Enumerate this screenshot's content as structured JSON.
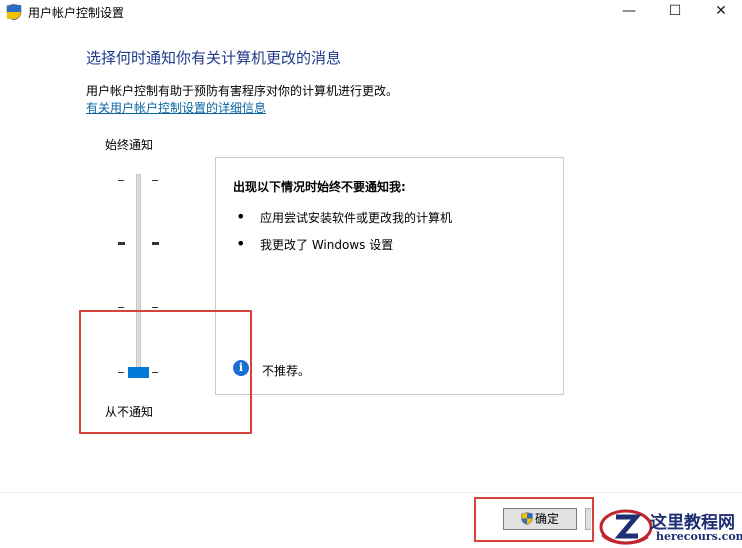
{
  "window": {
    "title": "用户帐户控制设置",
    "controls": {
      "minimize": "—",
      "maximize": "☐",
      "close": "✕"
    }
  },
  "main": {
    "headline": "选择何时通知你有关计算机更改的消息",
    "description": "用户帐户控制有助于预防有害程序对你的计算机进行更改。",
    "more_info_link": "有关用户帐户控制设置的详细信息"
  },
  "slider": {
    "top_label": "始终通知",
    "bottom_label": "从不通知",
    "levels": 4,
    "selected_level": 1
  },
  "info_box": {
    "title": "出现以下情况时始终不要通知我:",
    "items": [
      "应用尝试安装软件或更改我的计算机",
      "我更改了 Windows 设置"
    ],
    "recommendation": "不推荐。"
  },
  "footer": {
    "ok_label": "确定"
  },
  "watermark": {
    "site_name": "这里教程网",
    "url": "herecours.com"
  },
  "colors": {
    "headline": "#1e3a8a",
    "link": "#0a64a4",
    "slider_thumb": "#0078d7",
    "highlight": "#d9423a",
    "info_icon": "#1a6fd1"
  }
}
